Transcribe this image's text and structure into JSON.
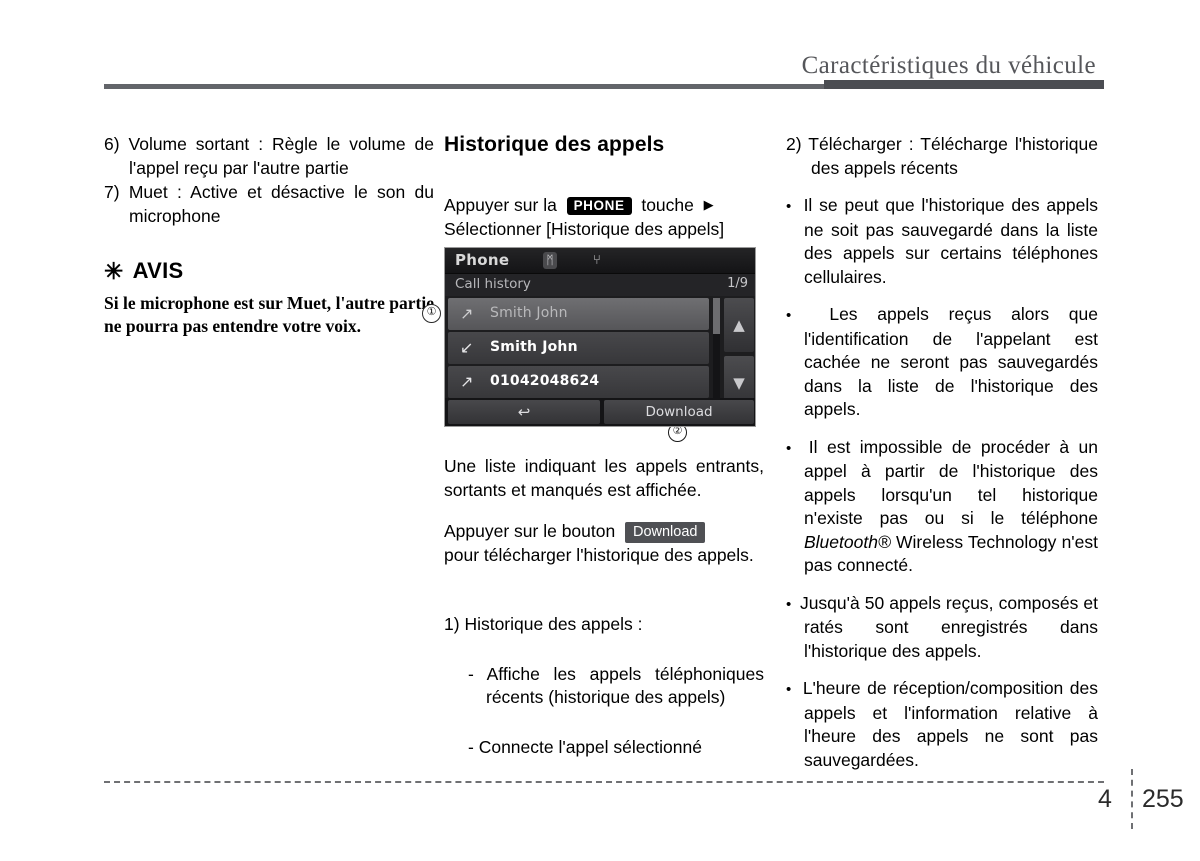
{
  "header": {
    "title": "Caractéristiques du véhicule"
  },
  "left_column": {
    "items": [
      {
        "num": "6)",
        "text": "Volume sortant : Règle le volume de l'appel reçu par l'autre partie"
      },
      {
        "num": "7)",
        "text": "Muet : Active et désactive le son du microphone"
      }
    ],
    "notice": {
      "asterisk": "✳",
      "heading": "AVIS",
      "body": "Si le microphone est sur Muet, l'autre partie ne pourra pas entendre votre voix."
    }
  },
  "middle_column": {
    "heading": "Historique des appels",
    "instruction_pre": "Appuyer sur la",
    "key_badge": "PHONE",
    "instruction_post": "touche",
    "arrow_glyph": "▶",
    "instruction_line2": "Sélectionner [Historique des appels]",
    "paragraph_1": "Une liste indiquant les appels entrants, sortants et manqués est affichée.",
    "paragraph_2_pre": "Appuyer sur le bouton",
    "download_badge": "Download",
    "paragraph_2_post": "pour télécharger l'historique des appels.",
    "list": [
      {
        "num": "1)",
        "text": "Historique des appels :"
      }
    ],
    "sublist": [
      {
        "dash": "-",
        "text": "Affiche les appels téléphoniques récents (historique des appels)"
      },
      {
        "dash": "-",
        "text": "Connecte l'appel sélectionné"
      }
    ]
  },
  "device": {
    "title": "Phone",
    "bluetooth_icon": "ᛗ",
    "usb_icon": "⑂",
    "subtitle": "Call history",
    "page_indicator": "1/9",
    "rows": [
      {
        "icon": "↗",
        "label": "Smith John",
        "state": "selected"
      },
      {
        "icon": "↙",
        "label": "Smith John",
        "state": "normal"
      },
      {
        "icon": "↗",
        "label": "01042048624",
        "state": "normal"
      }
    ],
    "arrow_up": "▲",
    "arrow_down": "▼",
    "back_button": "↩",
    "download_button": "Download",
    "callout_1": "①",
    "callout_2": "②"
  },
  "right_column": {
    "numbered": [
      {
        "num": "2)",
        "text": "Télécharger : Télécharge l'historique des appels récents"
      }
    ],
    "bullets": [
      {
        "text": "Il se peut que l'historique des appels ne soit pas sauvegardé dans la liste des appels sur certains téléphones cellulaires."
      },
      {
        "text": "Les appels reçus alors que l'identification de l'appelant est cachée ne seront pas sauvegardés dans la liste de l'historique des appels."
      },
      {
        "pre": "Il est impossible de procéder à un appel à partir de l'historique des appels lorsqu'un tel historique n'existe pas ou si le téléphone ",
        "italic": "Bluetooth®",
        "post": " Wireless Technology n'est pas connecté."
      },
      {
        "text": "Jusqu'à 50 appels reçus, composés et ratés sont enregistrés dans l'historique des appels."
      },
      {
        "text": "L'heure de réception/composition des appels et l'information relative à l'heure des appels ne sont pas sauvegardées."
      }
    ]
  },
  "footer": {
    "chapter": "4",
    "page": "255"
  }
}
